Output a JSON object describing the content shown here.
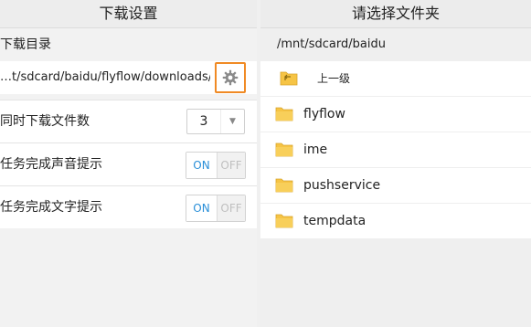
{
  "left_panel": {
    "title": "下载设置",
    "download_dir_label": "下载目录",
    "download_path": "…t/sdcard/baidu/flyflow/downloads/",
    "concurrent_label": "同时下载文件数",
    "concurrent_value": "3",
    "sound_label": "任务完成声音提示",
    "text_label": "任务完成文字提示",
    "toggle_on": "ON",
    "toggle_off": "OFF"
  },
  "right_panel": {
    "title": "请选择文件夹",
    "current_path": "/mnt/sdcard/baidu",
    "up_label": "上一级",
    "folders": [
      "flyflow",
      "ime",
      "pushservice",
      "tempdata"
    ]
  },
  "colors": {
    "accent_orange": "#f08a24",
    "toggle_on_blue": "#2a8fd8",
    "folder_yellow": "#f6c445"
  },
  "icons": {
    "settings": "gear-icon",
    "dropdown": "triangle-down-icon",
    "folder": "folder-icon",
    "parent": "folder-up-icon"
  }
}
